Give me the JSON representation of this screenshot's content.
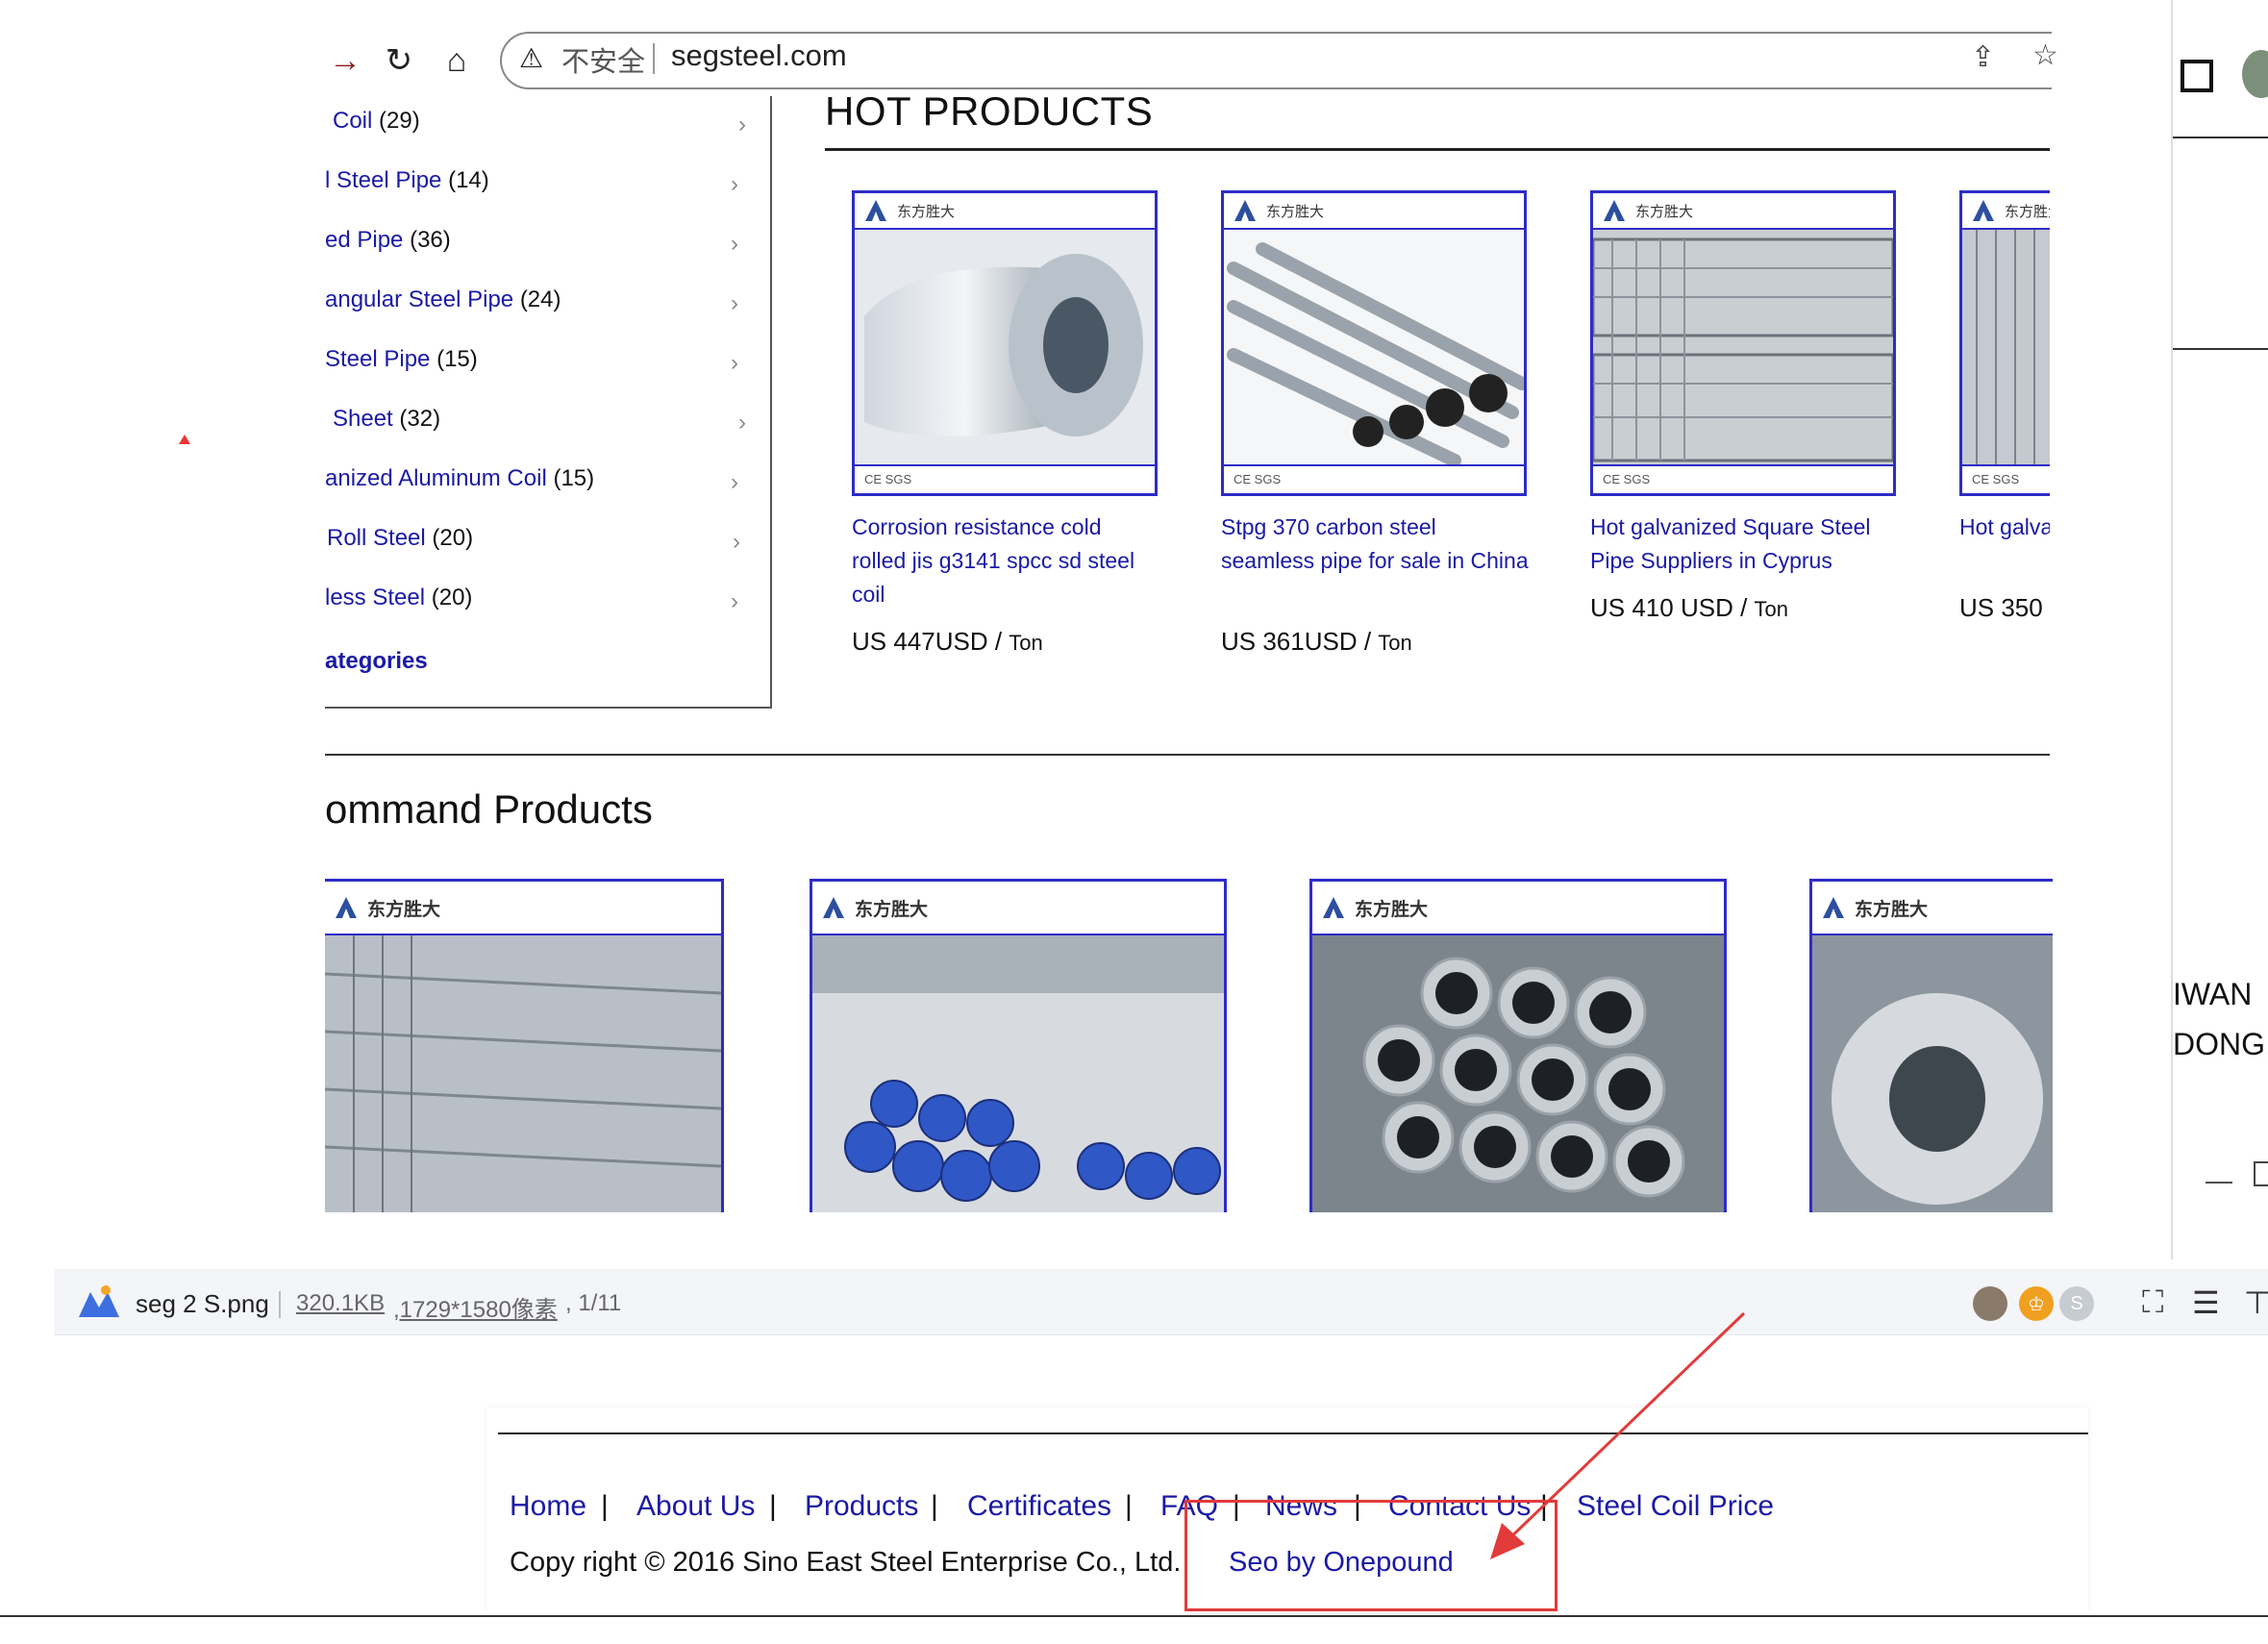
{
  "browser": {
    "address": {
      "not_secure": "不安全",
      "url": "segsteel.com"
    }
  },
  "sidebar": {
    "categories": [
      {
        "name": "Coil",
        "count": "(29)"
      },
      {
        "name": "l Steel Pipe",
        "count": "(14)"
      },
      {
        "name": "ed Pipe",
        "count": "(36)"
      },
      {
        "name": "angular Steel Pipe",
        "count": "(24)"
      },
      {
        "name": "Steel Pipe",
        "count": "(15)"
      },
      {
        "name": "Sheet",
        "count": "(32)"
      },
      {
        "name": "anized Aluminum Coil",
        "count": "(15)"
      },
      {
        "name": "Roll Steel",
        "count": "(20)"
      },
      {
        "name": "less Steel",
        "count": "(20)"
      }
    ],
    "all_categories": "ategories"
  },
  "hot_products": {
    "title": "HOT PRODUCTS",
    "items": [
      {
        "title": "Corrosion resistance cold rolled jis g3141 spcc sd steel coil",
        "price": "US 447USD",
        "unit": "Ton"
      },
      {
        "title": "Stpg 370 carbon steel seamless pipe for sale in China",
        "price": "US 361USD",
        "unit": "Ton"
      },
      {
        "title": "Hot galvanized Square Steel Pipe Suppliers in Cyprus",
        "price": "US 410 USD",
        "unit": "Ton"
      },
      {
        "title": "Hot galva made in I",
        "price": "US 350",
        "unit": ""
      }
    ],
    "logo_text": "东方胜大",
    "cert_text": "CE SGS"
  },
  "recommand": {
    "title": "ommand Products",
    "logo_text": "东方胜大"
  },
  "right_window": {
    "line1": "IWAN",
    "line2": "DONG,"
  },
  "viewer": {
    "filename": "seg 2 S.png",
    "size": "320.1KB",
    "dims": ",1729*1580像素",
    "page": ", 1/11"
  },
  "footer": {
    "links": [
      "Home",
      "About Us",
      "Products",
      "Certificates",
      "FAQ",
      "News",
      "Contact Us",
      "Steel Coil Price"
    ],
    "separator": "|",
    "copyright": "Copy right © 2016 Sino East Steel Enterprise Co., Ltd.",
    "seo": "Seo by Onepound"
  },
  "colors": {
    "link": "#1a1aa6",
    "frame": "#2d2cc8",
    "annotation": "#e23b3b"
  }
}
